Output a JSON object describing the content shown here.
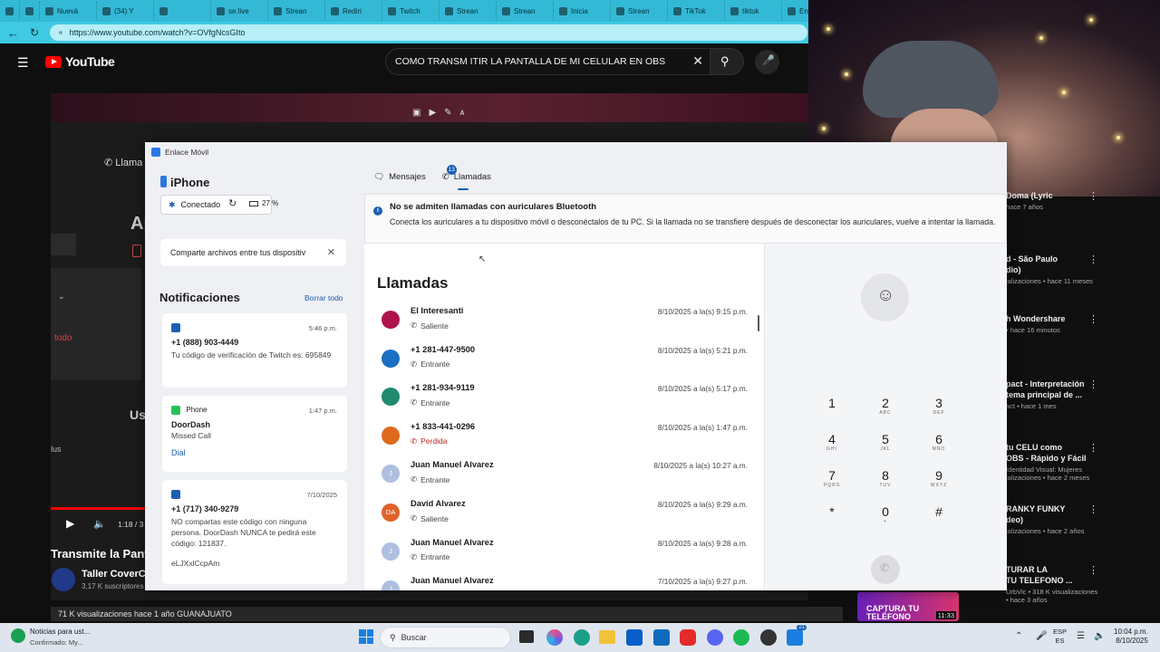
{
  "browser": {
    "tabs": [
      "Nuevá",
      "(34) Y",
      "",
      "se.live",
      "Strean",
      "Rediri",
      "Twitch",
      "Strean",
      "Strean",
      "Inicia",
      "Strean",
      "TikTok",
      "tiktok",
      "Encué"
    ],
    "url": "https://www.youtube.com/watch?v=OVfgNcsGIto"
  },
  "youtube": {
    "logo": "YouTube",
    "search_value": "COMO TRANSM ITIR LA PANTALLA DE MI CELULAR EN OBS",
    "left_fragments": [
      "Llama",
      "Ap",
      "todo",
      "Us",
      "lus"
    ],
    "video_time": "1:18 / 3",
    "video_title": "Transmite la Pant",
    "channel": "Taller CoverCa",
    "subscribers": "3,17 K suscriptores",
    "views": "71 K visualizaciones  hace 1 año  GUANAJUATO",
    "suggestions": [
      {
        "title": "Doma (Lyric",
        "meta": "hace 7 años"
      },
      {
        "title": "d - São Paulo\ndio)",
        "meta": "ializaciones • hace 11 meses"
      },
      {
        "title": "h Wondershare",
        "meta": "• hace 16 minutos"
      },
      {
        "title": "pact - Interpretación\ntema principal de ...",
        "meta": "act • hace 1 mes"
      },
      {
        "title": "tu CELU como\nOBS - Rápido y Fácil",
        "meta": "Identidad Visual: Mujeres\nializaciones • hace 2 meses"
      },
      {
        "title": "RANKY FUNKY\ndeo)",
        "meta": "ializaciones • hace 2 años"
      },
      {
        "title": "TURAR LA\nTU TELEFONO ...",
        "meta": "UrbVic • 318 K visualizaciones • hace 3 años"
      }
    ],
    "thumb_text": "CAPTURA TU TELÉFONO",
    "thumb_time": "11:33"
  },
  "phonelink": {
    "window_title": "Enlace Móvil",
    "device": "iPhone",
    "connected": "Conectado",
    "battery": "27 %",
    "share_banner": "Comparte archivos entre tus dispositiv",
    "notifications_title": "Notificaciones",
    "clear_all": "Borrar todo",
    "notifications": [
      {
        "app": "",
        "time": "5:46 p.m.",
        "title": "+1 (888) 903-4449",
        "body": "Tu código de verificación de Twitch es: 695849",
        "action": ""
      },
      {
        "app": "Phone",
        "time": "1:47 p.m.",
        "title": "DoorDash",
        "body": "Missed Call",
        "action": "Dial"
      },
      {
        "app": "",
        "time": "7/10/2025",
        "title": "+1 (717) 340-9279",
        "body": "NO compartas este código con ninguna persona. DoorDash NUNCA te pedirá este código: 121837.",
        "action": "eLJXxlCcpAm"
      }
    ],
    "tabs": {
      "messages": "Mensajes",
      "calls": "Llamadas",
      "calls_badge": "13"
    },
    "info_title": "No se admiten llamadas con auriculares Bluetooth",
    "info_body": "Conecta los auriculares a tu dispositivo móvil o desconéctalos de tu PC. Si la llamada no se transfiere después de desconectar los auriculares, vuelve a intentar la llamada.",
    "calls_title": "Llamadas",
    "calls": [
      {
        "name": "El Interesanti",
        "type": "Saliente",
        "date": "8/10/2025 a la(s) 9:15 p.m.",
        "initials": "",
        "color": "#b0124d",
        "missed": false
      },
      {
        "name": "+1 281-447-9500",
        "type": "Entrante",
        "date": "8/10/2025 a la(s) 5:21 p.m.",
        "initials": "",
        "color": "#1a6fc4",
        "missed": false
      },
      {
        "name": "+1 281-934-9119",
        "type": "Entrante",
        "date": "8/10/2025 a la(s) 5:17 p.m.",
        "initials": "",
        "color": "#1f8a70",
        "missed": false
      },
      {
        "name": "+1 833-441-0296",
        "type": "Perdida",
        "date": "8/10/2025 a la(s) 1:47 p.m.",
        "initials": "",
        "color": "#e06a1b",
        "missed": true
      },
      {
        "name": "Juan Manuel Alvarez",
        "type": "Entrante",
        "date": "8/10/2025 a la(s) 10:27 a.m.",
        "initials": "J",
        "color": "#aebfe0",
        "missed": false
      },
      {
        "name": "David Alvarez",
        "type": "Saliente",
        "date": "8/10/2025 a la(s) 9:29 a.m.",
        "initials": "DA",
        "color": "#e0622a",
        "missed": false
      },
      {
        "name": "Juan Manuel Alvarez",
        "type": "Entrante",
        "date": "8/10/2025 a la(s) 9:28 a.m.",
        "initials": "J",
        "color": "#aebfe0",
        "missed": false
      },
      {
        "name": "Juan Manuel Alvarez",
        "type": "Entrante",
        "date": "7/10/2025 a la(s) 9:27 p.m.",
        "initials": "J",
        "color": "#aebfe0",
        "missed": false
      }
    ],
    "dialpad": [
      {
        "n": "1",
        "l": ""
      },
      {
        "n": "2",
        "l": "ABC"
      },
      {
        "n": "3",
        "l": "DEF"
      },
      {
        "n": "4",
        "l": "GHI"
      },
      {
        "n": "5",
        "l": "JKL"
      },
      {
        "n": "6",
        "l": "MNO"
      },
      {
        "n": "7",
        "l": "PQRS"
      },
      {
        "n": "8",
        "l": "TUV"
      },
      {
        "n": "9",
        "l": "WXYZ"
      },
      {
        "n": "*",
        "l": ""
      },
      {
        "n": "0",
        "l": "+"
      },
      {
        "n": "#",
        "l": ""
      }
    ]
  },
  "taskbar": {
    "news_title": "Noticias para ust...",
    "news_sub": "Confirmado: My...",
    "search": "Buscar",
    "lang1": "ESP",
    "lang2": "ES",
    "time": "10:04 p.m.",
    "date": "8/10/2025",
    "badge": "21"
  }
}
